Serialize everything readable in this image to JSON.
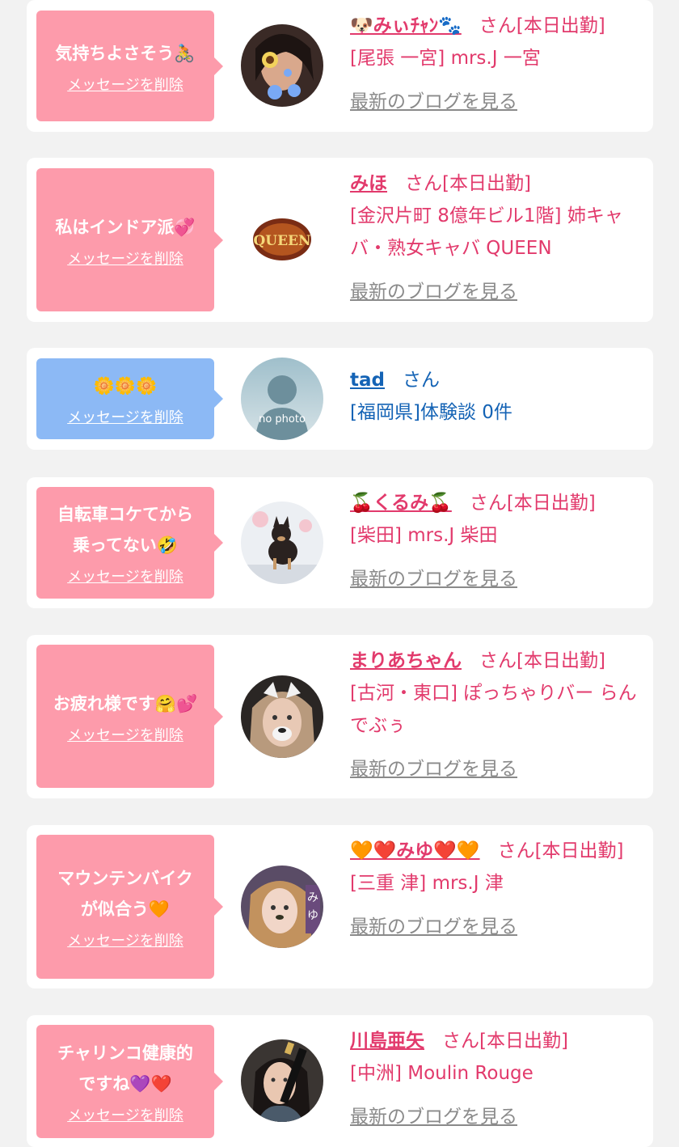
{
  "delete_label": "メッセージを削除",
  "san_label": "さん",
  "blog_label": "最新のブログを見る",
  "cards": [
    {
      "message": "気持ちよさそう🚴",
      "name": "🐶みぃﾁｬﾝ🐾",
      "status": "[本日出勤]",
      "shop": "[尾張 一宮] mrs.J 一宮"
    },
    {
      "message": "私はインドア派💞",
      "name": "みほ",
      "status": "[本日出勤]",
      "shop": "[金沢片町 8億年ビル1階] 姉キャバ・熟女キャバ QUEEN"
    },
    {
      "message": "🌼🌼🌼",
      "name": "tad",
      "status": "",
      "shop": "[福岡県]体験談 0件",
      "avatar_text": "no photo"
    },
    {
      "message": "自転車コケてから\n乗ってない🤣",
      "name": "🍒くるみ🍒",
      "status": "[本日出勤]",
      "shop": "[柴田] mrs.J 柴田"
    },
    {
      "message": "お疲れ様です🤗💕",
      "name": "まりあちゃん",
      "status": "[本日出勤]",
      "shop": "[古河・東口] ぽっちゃりバー らんでぶぅ"
    },
    {
      "message": "マウンテンバイク\nが似合う🧡",
      "name": "🧡❤️みゆ❤️🧡",
      "status": "[本日出勤]",
      "shop": "[三重 津] mrs.J 津"
    },
    {
      "message": "チャリンコ健康的\nですね💜❤️",
      "name": "川島亜矢",
      "status": "[本日出勤]",
      "shop": "[中洲] Moulin Rouge"
    }
  ],
  "colors": {
    "pink_bubble": "#fd9bab",
    "blue_bubble": "#8cb9f5",
    "name_pink": "#e23a6c",
    "name_blue": "#1463b5",
    "link_gray": "#8a8a8a"
  }
}
